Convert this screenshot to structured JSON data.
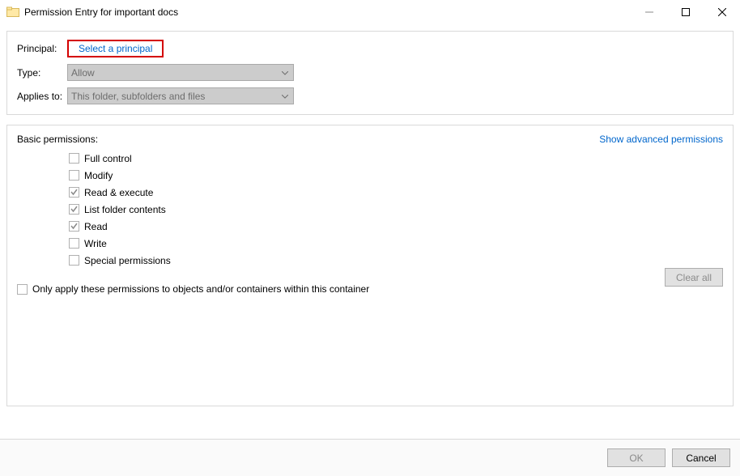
{
  "window": {
    "title": "Permission Entry for important docs"
  },
  "principal": {
    "label": "Principal:",
    "link": "Select a principal"
  },
  "type": {
    "label": "Type:",
    "value": "Allow"
  },
  "applies": {
    "label": "Applies to:",
    "value": "This folder, subfolders and files"
  },
  "basic": {
    "header": "Basic permissions:",
    "advanced_link": "Show advanced permissions",
    "items": [
      {
        "label": "Full control",
        "checked": false
      },
      {
        "label": "Modify",
        "checked": false
      },
      {
        "label": "Read & execute",
        "checked": true
      },
      {
        "label": "List folder contents",
        "checked": true
      },
      {
        "label": "Read",
        "checked": true
      },
      {
        "label": "Write",
        "checked": false
      },
      {
        "label": "Special permissions",
        "checked": false
      }
    ]
  },
  "only_apply": {
    "label": "Only apply these permissions to objects and/or containers within this container",
    "checked": false
  },
  "buttons": {
    "clear_all": "Clear all",
    "ok": "OK",
    "cancel": "Cancel"
  }
}
